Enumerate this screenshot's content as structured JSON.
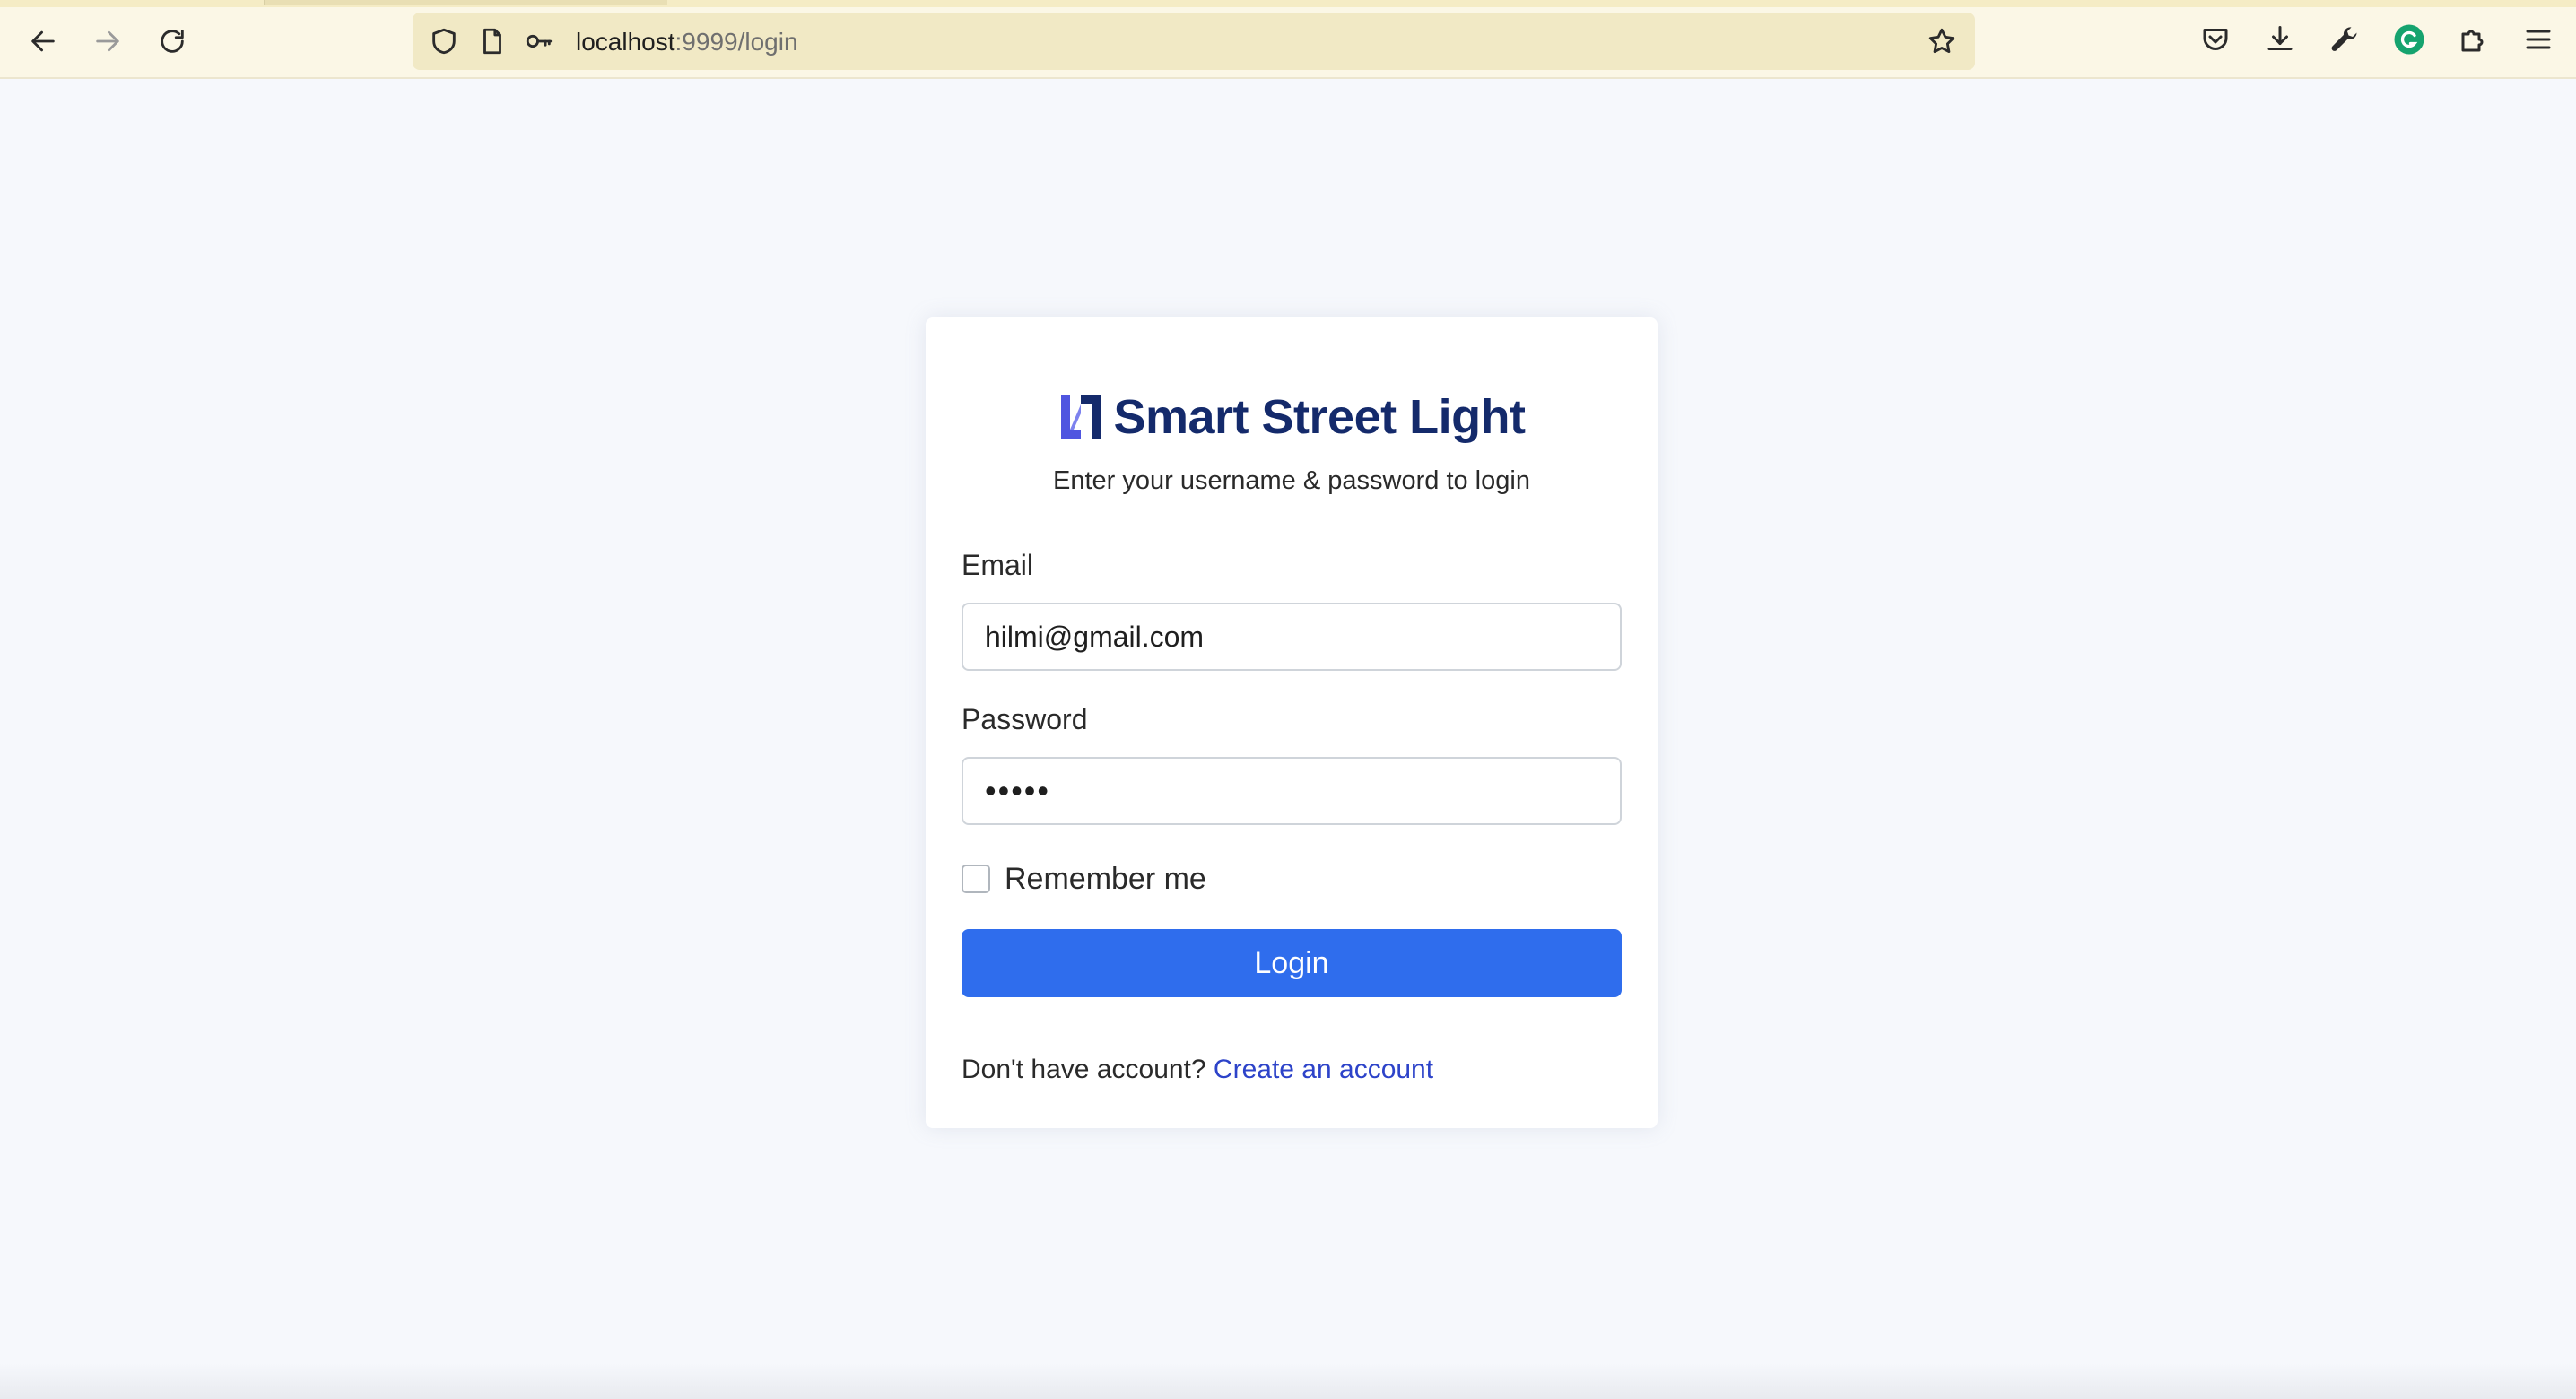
{
  "browser": {
    "url_host": "localhost",
    "url_path": ":9999/login"
  },
  "login": {
    "brand_name": "Smart Street Light",
    "subtitle": "Enter your username & password to login",
    "email_label": "Email",
    "email_value": "hilmi@gmail.com",
    "password_label": "Password",
    "password_value": "•••••",
    "remember_label": "Remember me",
    "remember_checked": false,
    "login_button": "Login",
    "no_account_text": "Don't have account?",
    "create_account_link": "Create an account"
  },
  "colors": {
    "primary_button": "#2f6ded",
    "brand_text": "#142a6b",
    "link": "#2d43c9",
    "logo_accent": "#4f55e0"
  },
  "icons": {
    "back": "back-arrow-icon",
    "forward": "forward-arrow-icon",
    "reload": "reload-icon",
    "shield": "tracking-shield-icon",
    "page": "page-info-icon",
    "key": "key-icon",
    "bookmark": "star-icon",
    "pocket": "pocket-icon",
    "downloads": "download-icon",
    "tools": "wrench-icon",
    "profile": "grammarly-icon",
    "extensions": "puzzle-icon",
    "menu": "hamburger-menu-icon"
  }
}
